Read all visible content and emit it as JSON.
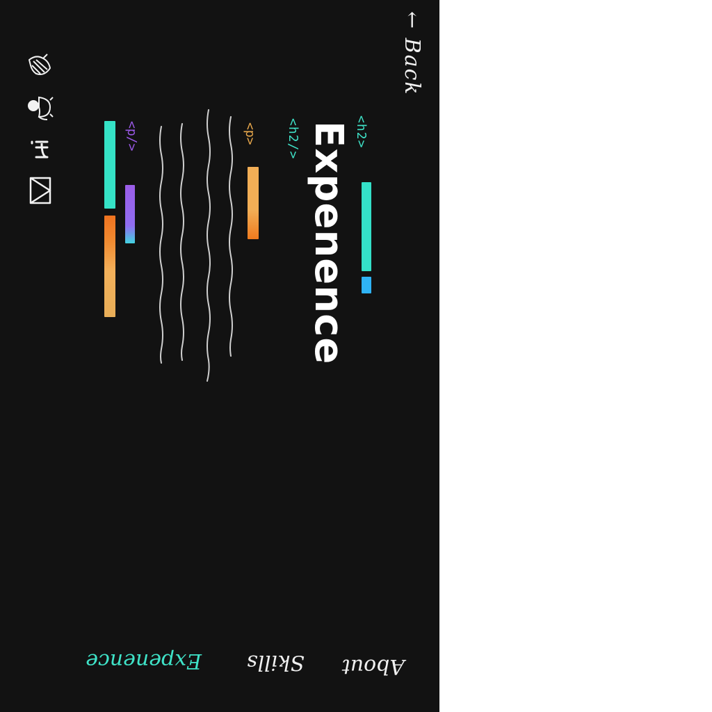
{
  "header": {
    "back_label": "← Back"
  },
  "section": {
    "h2_open_tag": "<h2>",
    "h2_close_tag": "<h2/>",
    "title": "Expenence",
    "p_open_tag": "<p>",
    "p_close_tag": "<p/>"
  },
  "nav": {
    "items": [
      {
        "label": "About"
      },
      {
        "label": "Skills"
      },
      {
        "label": "Expenence"
      }
    ]
  },
  "social": {
    "icons": [
      "bird-icon",
      "github-icon",
      "linkedin-icon",
      "mail-icon"
    ]
  },
  "colors": {
    "background": "#121212",
    "accent": "#3fe3c8",
    "orange": "#f2ae56",
    "purple": "#9b5de8",
    "blue": "#2fb3f5"
  }
}
